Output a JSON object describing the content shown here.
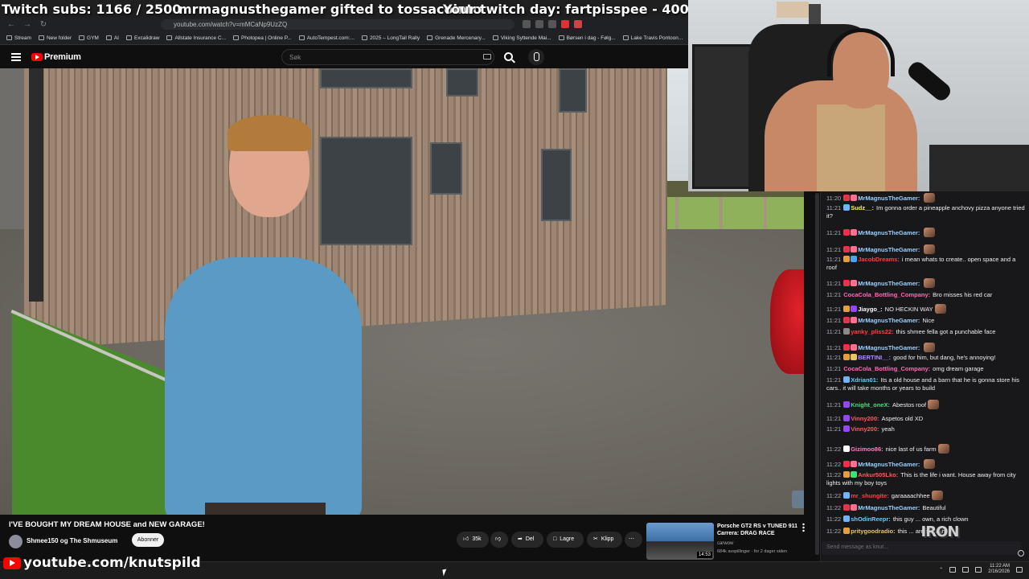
{
  "overlay": {
    "subs": "Twitch subs: 1166 / 2500",
    "gifter": "mrmagnusthegamer gifted to tossacointo",
    "yourtwitch": "Your twitch day: fartpisspee - 400",
    "youtube_handle": "youtube.com/knutspild"
  },
  "browser": {
    "url": "youtube.com/watch?v=mMCaNp9UzZQ",
    "bookmarks": [
      "Stream",
      "New folder",
      "GYM",
      "AI",
      "Excalidraw",
      "Allstate Insurance C...",
      "Photopea | Online P...",
      "AutoTempest.com:...",
      "2025 – LongTail Rally",
      "Grenade Mercenary...",
      "Viking Syttende Mai...",
      "Børsen i dag - Følg...",
      "Lake Travis Pontoon..."
    ]
  },
  "youtube": {
    "brand": "Premium",
    "search_placeholder": "Søk",
    "video_title": "I'VE BOUGHT MY DREAM HOUSE and NEW GARAGE!",
    "channel": "Shmee150 og The Shmuseum",
    "subscribe": "Abonner",
    "likes": "35k",
    "share": "Del",
    "save": "Lagre",
    "clip": "Klipp"
  },
  "recommendation": {
    "title": "Porsche GT2 RS v TUNED 911 Carrera: DRAG RACE",
    "channel": "carwow",
    "views": "684k avspillinger · for 2 dager siden",
    "duration": "14:53"
  },
  "chat": {
    "input_placeholder": "Send message as knut...",
    "messages": [
      {
        "ts": "11:20",
        "user": "MrMagnusTheGamer:",
        "text": "",
        "color": "#9bd0ff",
        "badges": [
          "#f0304a",
          "#ff6f91"
        ],
        "emote": true
      },
      {
        "ts": "11:21",
        "user": "Sudz__:",
        "text": "Im gonna order a pineapple anchovy pizza anyone tried it?",
        "color": "#f9f55c",
        "badges": [
          "#6fb4ff"
        ],
        "emote": false
      },
      {
        "ts": "11:21",
        "user": "MrMagnusTheGamer:",
        "text": "",
        "color": "#9bd0ff",
        "badges": [
          "#f0304a",
          "#ff6f91"
        ],
        "emote": true
      },
      {
        "ts": "11:21",
        "user": "MrMagnusTheGamer:",
        "text": "",
        "color": "#9bd0ff",
        "badges": [
          "#f0304a",
          "#ff6f91"
        ],
        "emote": true
      },
      {
        "ts": "11:21",
        "user": "JacobDreams:",
        "text": "i mean whats to create.. open space and a roof",
        "color": "#ff4040",
        "badges": [
          "#e5a03c",
          "#46a3ff"
        ],
        "emote": false
      },
      {
        "ts": "11:21",
        "user": "MrMagnusTheGamer:",
        "text": "",
        "color": "#9bd0ff",
        "badges": [
          "#f0304a",
          "#ff6f91"
        ],
        "emote": true
      },
      {
        "ts": "11:21",
        "user": "CocaCola_Bottling_Company:",
        "text": "Bro misses his red car",
        "color": "#ff69b4",
        "badges": [],
        "emote": false
      },
      {
        "ts": "11:21",
        "user": "Jiaygo_:",
        "text": "NO HECKIN WAY",
        "color": "#ffffff",
        "badges": [
          "#e5a03c",
          "#9147ff"
        ],
        "emote": true
      },
      {
        "ts": "11:21",
        "user": "MrMagnusTheGamer:",
        "text": "Nice",
        "color": "#9bd0ff",
        "badges": [
          "#f0304a",
          "#ff6f91"
        ],
        "emote": false
      },
      {
        "ts": "11:21",
        "user": "yanky_pliss22:",
        "text": "this shmee fella got a punchable face",
        "color": "#ff4040",
        "badges": [
          "#8a8a8a"
        ],
        "emote": false
      },
      {
        "ts": "11:21",
        "user": "MrMagnusTheGamer:",
        "text": "",
        "color": "#9bd0ff",
        "badges": [
          "#f0304a",
          "#ff6f91"
        ],
        "emote": true
      },
      {
        "ts": "11:21",
        "user": "BERTINI__:",
        "text": "good for him, but dang, he's annoying!",
        "color": "#b58aff",
        "badges": [
          "#e5a03c",
          "#e8c56a"
        ],
        "emote": false
      },
      {
        "ts": "11:21",
        "user": "CocaCola_Bottling_Company:",
        "text": "omg dream garage",
        "color": "#ff69b4",
        "badges": [],
        "emote": false
      },
      {
        "ts": "11:21",
        "user": "Xdrian01:",
        "text": "Its a old house and a barn that he is gonna store his cars.. it will take months or years to build",
        "color": "#5fd0ff",
        "badges": [
          "#6fb4ff"
        ],
        "emote": false
      },
      {
        "ts": "11:21",
        "user": "Knight_oneX:",
        "text": "Abestos roof",
        "color": "#3ee07a",
        "badges": [
          "#9147ff"
        ],
        "emote": true
      },
      {
        "ts": "11:21",
        "user": "Vinny200:",
        "text": "Aspetos old XD",
        "color": "#ff5a5a",
        "badges": [
          "#9147ff"
        ],
        "emote": false
      },
      {
        "ts": "11:21",
        "user": "Vinny200:",
        "text": "yeah",
        "color": "#ff5a5a",
        "badges": [
          "#9147ff"
        ],
        "emote": false
      },
      {
        "ts": "11:22",
        "user": "Gizimoo86:",
        "text": "nice last of us farm",
        "color": "#ff7fbf",
        "badges": [
          "#ffffff"
        ],
        "emote": true
      },
      {
        "ts": "11:22",
        "user": "MrMagnusTheGamer:",
        "text": "",
        "color": "#9bd0ff",
        "badges": [
          "#f0304a",
          "#ff6f91"
        ],
        "emote": true
      },
      {
        "ts": "11:22",
        "user": "Ankur505Lko:",
        "text": "This is the life i want. House away from city lights with my boy toys",
        "color": "#ff5a5a",
        "badges": [
          "#e5a03c",
          "#3ee07a"
        ],
        "emote": false
      },
      {
        "ts": "11:22",
        "user": "mr_shungite:",
        "text": "garaaaachhee",
        "color": "#ff4040",
        "badges": [
          "#6fb4ff"
        ],
        "emote": true
      },
      {
        "ts": "11:22",
        "user": "MrMagnusTheGamer:",
        "text": "Beautiful",
        "color": "#9bd0ff",
        "badges": [
          "#f0304a",
          "#ff6f91"
        ],
        "emote": false
      },
      {
        "ts": "11:22",
        "user": "shOdinReepr:",
        "text": "this guy ... own, a rich clown",
        "color": "#5fd0ff",
        "badges": [
          "#6fb4ff"
        ],
        "emote": false
      },
      {
        "ts": "11:22",
        "user": "pritygoodradio:",
        "text": "this ... are so high",
        "color": "#e8c56a",
        "badges": [
          "#e5a03c"
        ],
        "emote": false
      }
    ]
  },
  "taskbar": {
    "time": "11:22 AM",
    "date": "2/16/2026"
  },
  "icons": [
    "hamburger-icon",
    "youtube-logo-icon",
    "search-icon",
    "keyboard-icon",
    "mic-icon",
    "like-icon",
    "dislike-icon",
    "share-icon",
    "save-icon",
    "clip-icon",
    "more-icon",
    "gear-icon"
  ]
}
